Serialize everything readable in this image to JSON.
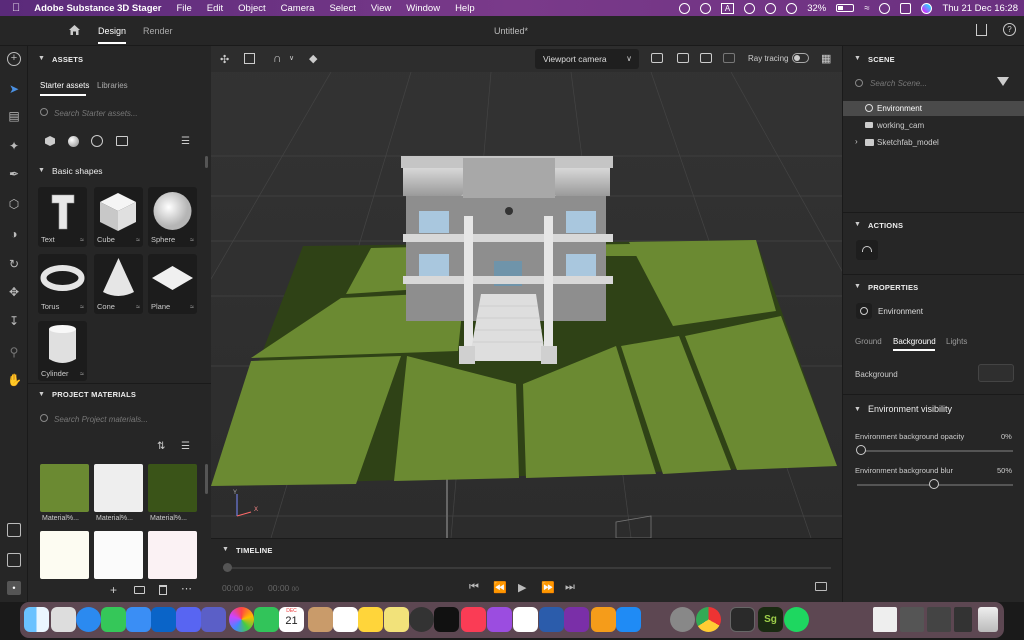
{
  "menubar": {
    "app": "Adobe Substance 3D Stager",
    "items": [
      "File",
      "Edit",
      "Object",
      "Camera",
      "Select",
      "View",
      "Window",
      "Help"
    ],
    "battery": "32%",
    "datetime": "Thu 21 Dec  16:28"
  },
  "titlebar": {
    "tab_design": "Design",
    "tab_render": "Render",
    "doc_title": "Untitled*"
  },
  "assets": {
    "header": "ASSETS",
    "tab_starter": "Starter assets",
    "tab_libraries": "Libraries",
    "search_placeholder": "Search Starter assets...",
    "basic_shapes": "Basic shapes",
    "shapes": [
      "Text",
      "Cube",
      "Sphere",
      "Torus",
      "Cone",
      "Plane",
      "Cylinder"
    ]
  },
  "project_materials": {
    "header": "PROJECT MATERIALS",
    "search_placeholder": "Search Project materials...",
    "materials": [
      {
        "label": "Material%...",
        "color": "#6b8a32"
      },
      {
        "label": "Material%...",
        "color": "#eeeeee"
      },
      {
        "label": "Material%...",
        "color": "#3a5418"
      },
      {
        "label": "",
        "color": "#fdfcf2"
      },
      {
        "label": "",
        "color": "#fbfbfb"
      },
      {
        "label": "",
        "color": "#fbf2f4"
      }
    ]
  },
  "viewport": {
    "camera": "Viewport camera",
    "ray_tracing": "Ray tracing",
    "axis_y": "Y",
    "axis_x": "X"
  },
  "timeline": {
    "header": "TIMELINE",
    "t1": "00:00",
    "t1b": "00",
    "t2": "00:00",
    "t2b": "00"
  },
  "scene": {
    "header": "SCENE",
    "search_placeholder": "Search Scene...",
    "items": [
      "Environment",
      "working_cam",
      "Sketchfab_model"
    ]
  },
  "actions": {
    "header": "ACTIONS"
  },
  "properties": {
    "header": "PROPERTIES",
    "object": "Environment",
    "tab_ground": "Ground",
    "tab_background": "Background",
    "tab_lights": "Lights",
    "background_label": "Background",
    "env_visibility": "Environment visibility",
    "opacity_label": "Environment background opacity",
    "opacity_value": "0%",
    "blur_label": "Environment background blur",
    "blur_value": "50%"
  },
  "dock": {
    "calendar_month": "DEC",
    "calendar_day": "21"
  },
  "colors": {
    "accent": "#1473e6",
    "grass": "#6b8a32",
    "grass_dark": "#2f4216"
  }
}
